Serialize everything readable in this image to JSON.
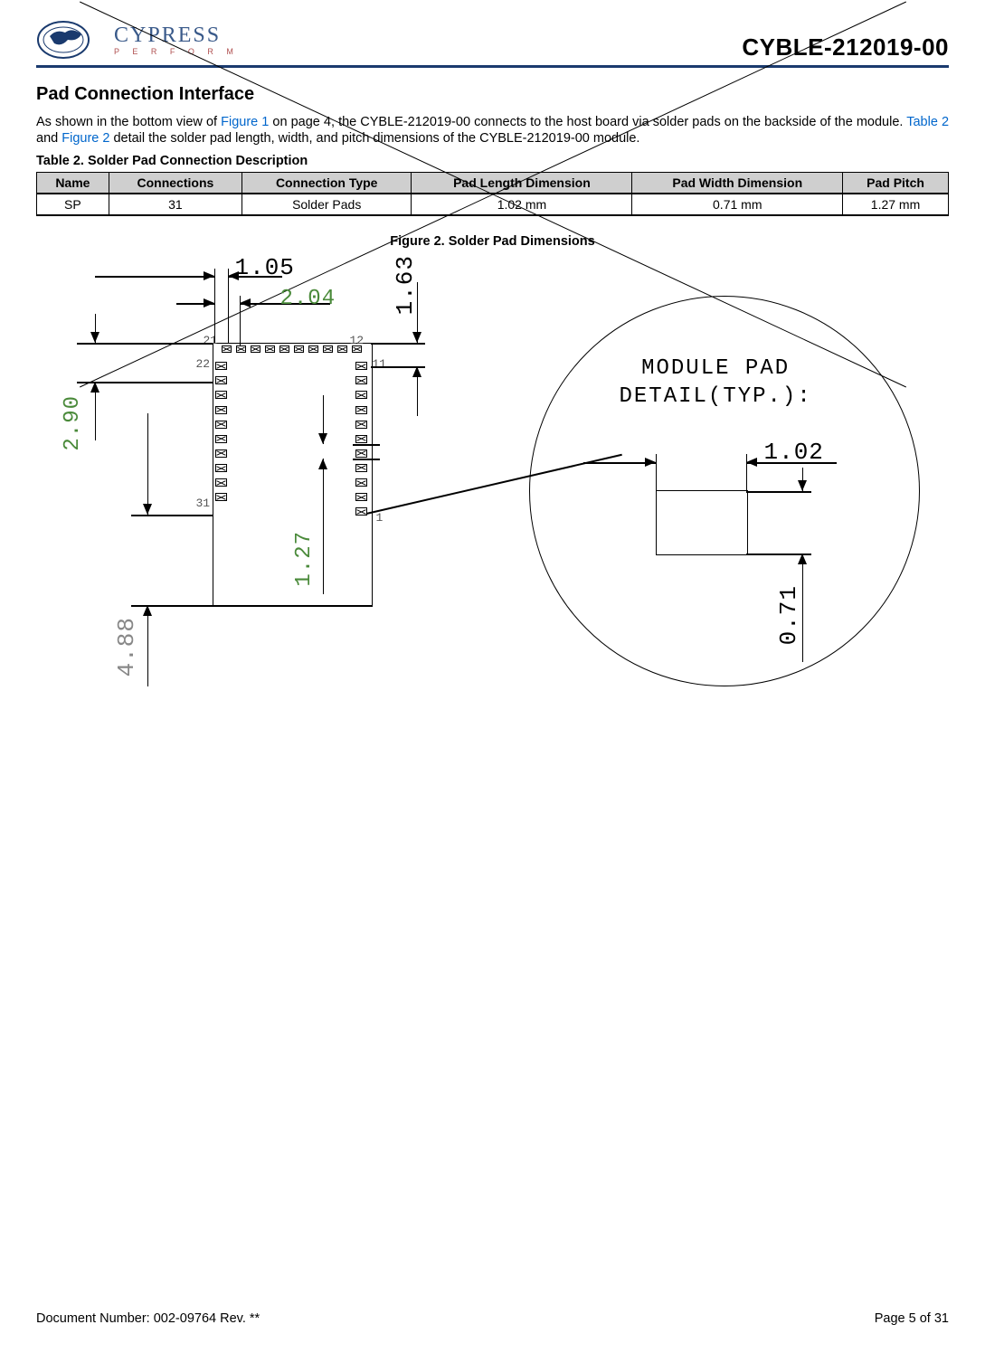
{
  "header": {
    "brand": "CYPRESS",
    "tagline": "P E R F O R M",
    "part_number": "CYBLE-212019-00"
  },
  "section_title": "Pad Connection Interface",
  "paragraph": {
    "before_fig1": "As shown in the bottom view of ",
    "fig1_link": "Figure 1",
    "after_fig1": " on page 4, the CYBLE-212019-00 connects to the host board via solder pads on the backside of the module. ",
    "table2_link": "Table 2",
    "between": " and ",
    "fig2_link": "Figure 2",
    "after_fig2": " detail the solder pad length, width, and pitch dimensions of the CYBLE-212019-00 module."
  },
  "table": {
    "caption": "Table 2.  Solder Pad Connection Description",
    "headers": {
      "name": "Name",
      "connections": "Connections",
      "type": "Connection Type",
      "length": "Pad Length Dimension",
      "width": "Pad Width Dimension",
      "pitch": "Pad Pitch"
    },
    "row": {
      "name": "SP",
      "connections": "31",
      "type": "Solder Pads",
      "length": "1.02 mm",
      "width": "0.71 mm",
      "pitch": "1.27 mm"
    }
  },
  "figure": {
    "caption": "Figure 2.  Solder Pad Dimensions",
    "dims": {
      "d1": "1.05",
      "d2": "2.04",
      "d3": "1.63",
      "d4": "2.90",
      "d5": "4.88",
      "d6": "1.27",
      "detail_title": "MODULE PAD\nDETAIL(TYP.):",
      "d_len": "1.02",
      "d_wid": "0.71"
    },
    "pins": {
      "p1": "1",
      "p11": "11",
      "p12": "12",
      "p21": "21",
      "p22": "22",
      "p31": "31"
    }
  },
  "footer": {
    "doc": "Document Number: 002-09764 Rev. **",
    "page": "Page 5 of 31"
  }
}
